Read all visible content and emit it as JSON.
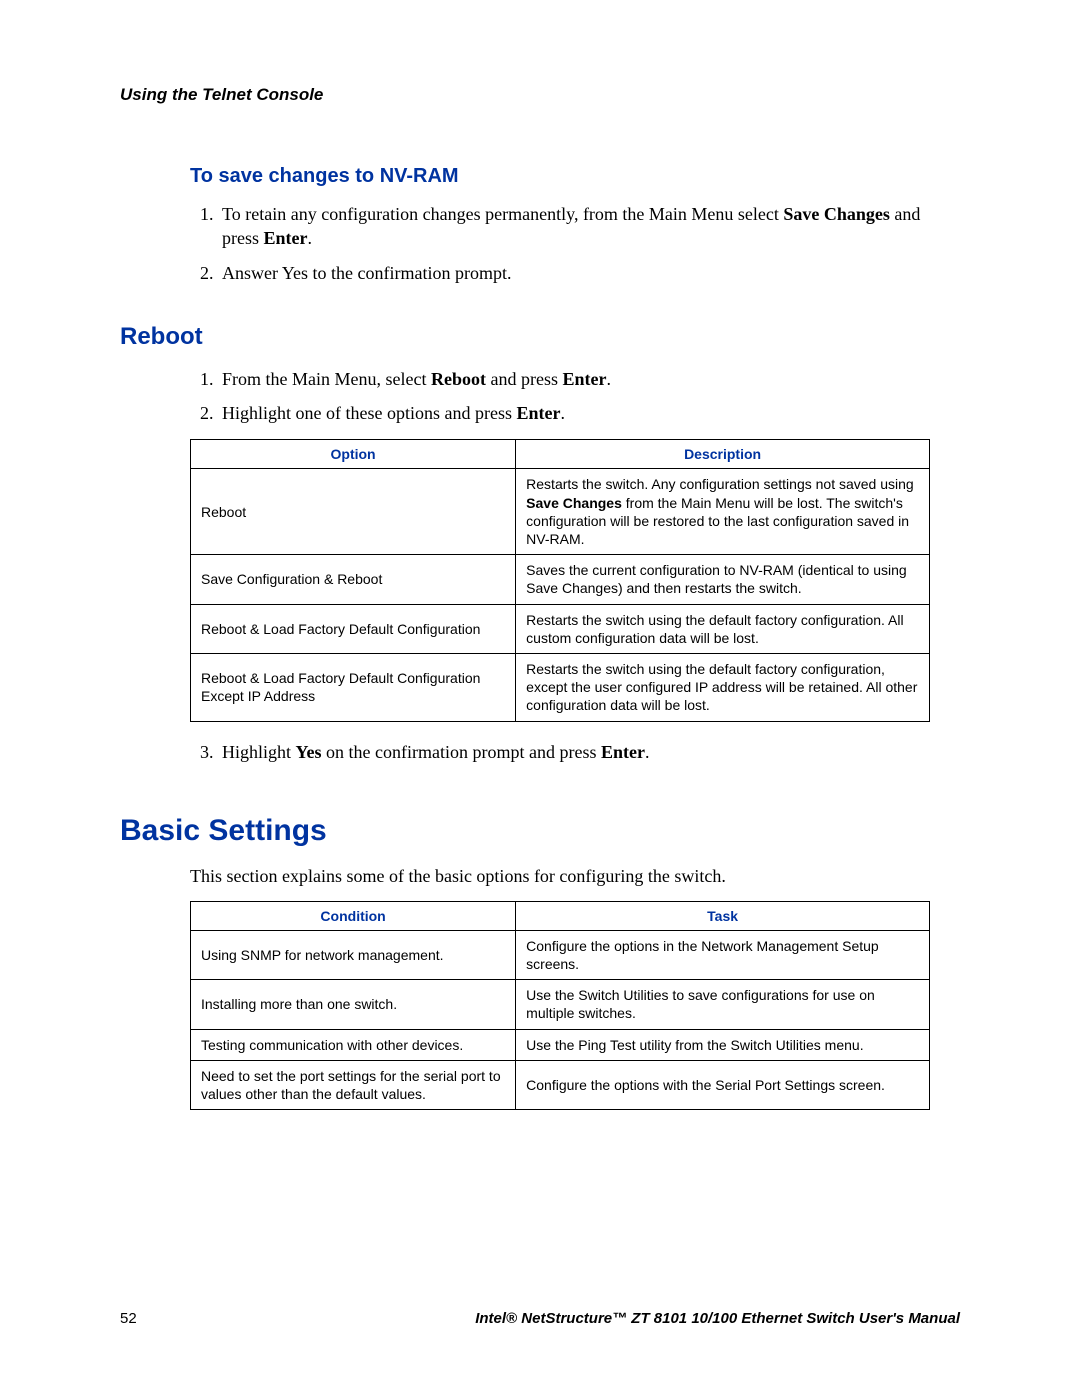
{
  "header": {
    "running_head": "Using the Telnet Console"
  },
  "s1": {
    "title": "To save changes to NV-RAM",
    "li1a": "To retain any configuration changes permanently, from the Main Menu select ",
    "li1b": "Save Changes",
    "li1c": " and press ",
    "li1d": "Enter",
    "li1e": ".",
    "li2": "Answer Yes to the confirmation prompt."
  },
  "s2": {
    "title": "Reboot",
    "li1a": "From the Main Menu, select ",
    "li1b": "Reboot",
    "li1c": " and press ",
    "li1d": "Enter",
    "li1e": ".",
    "li2a": "Highlight one of these options and press ",
    "li2b": "Enter",
    "li2c": ".",
    "li3a": "Highlight ",
    "li3b": "Yes",
    "li3c": " on the confirmation prompt and press ",
    "li3d": "Enter",
    "li3e": "."
  },
  "t1": {
    "h1": "Option",
    "h2": "Description",
    "r1c1": "Reboot",
    "r1c2a": "Restarts the switch. Any configuration settings not saved using ",
    "r1c2b": "Save Changes",
    "r1c2c": " from the Main Menu will be lost. The switch's configuration will be restored to the last configuration saved in NV-RAM.",
    "r2c1": "Save Configuration & Reboot",
    "r2c2": "Saves the current configuration to NV-RAM (identical to using Save Changes) and then restarts the switch.",
    "r3c1": "Reboot & Load Factory Default Configuration",
    "r3c2": "Restarts the switch using the default factory configuration. All custom configuration data will be lost.",
    "r4c1": "Reboot & Load Factory Default Configuration Except IP Address",
    "r4c2": "Restarts the switch using the default factory configuration, except the user configured IP address will be retained. All other configuration data will be lost."
  },
  "s3": {
    "title": "Basic Settings",
    "intro": "This section explains some of the basic options for configuring the switch."
  },
  "t2": {
    "h1": "Condition",
    "h2": "Task",
    "r1c1": "Using SNMP for network management.",
    "r1c2": "Configure the options in the Network Management Setup screens.",
    "r2c1": "Installing more than one switch.",
    "r2c2": "Use the Switch Utilities to save configurations for use on multiple switches.",
    "r3c1": "Testing communication with other devices.",
    "r3c2": "Use the Ping Test utility from the Switch Utilities menu.",
    "r4c1": "Need to set the port settings for the serial port to values other than the default values.",
    "r4c2": "Configure the options with the Serial Port Settings screen."
  },
  "footer": {
    "page": "52",
    "manual": "Intel® NetStructure™  ZT 8101 10/100 Ethernet Switch User's Manual"
  }
}
